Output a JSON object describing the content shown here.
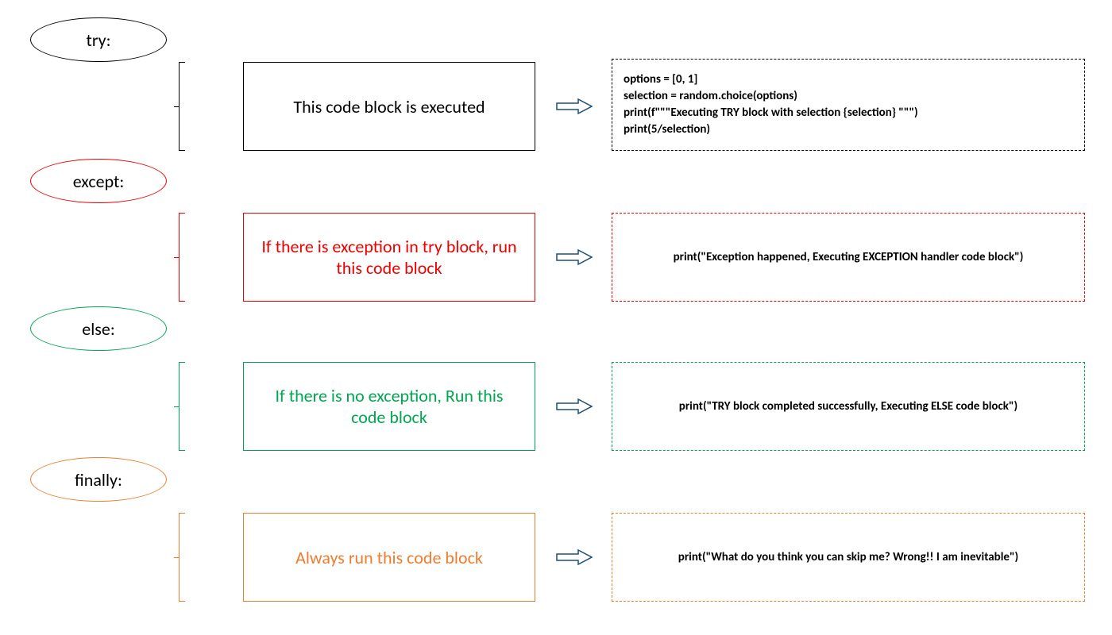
{
  "colors": {
    "try": "#000000",
    "except": "#ed0000",
    "else": "#00a651",
    "finally": "#ed7d31",
    "arrow": "#1f4e79"
  },
  "sections": {
    "try": {
      "label": "try:",
      "description": "This code block is executed",
      "code": [
        "options = [0, 1]",
        "selection = random.choice(options)",
        "print(f\"\"\"Executing TRY block with selection {selection} \"\"\")",
        "print(5/selection)"
      ]
    },
    "except": {
      "label": "except:",
      "description": "If there is exception in try block, run this code block",
      "code": [
        "print(\"Exception happened, Executing EXCEPTION handler code block\")"
      ]
    },
    "else": {
      "label": "else:",
      "description": "If there is no exception, Run this code block",
      "code": [
        "print(\"TRY block completed successfully, Executing ELSE code block\")"
      ]
    },
    "finally": {
      "label": "finally:",
      "description": "Always run this code block",
      "code": [
        "print(\"What do you think you can skip me? Wrong!! I am inevitable\")"
      ]
    }
  }
}
